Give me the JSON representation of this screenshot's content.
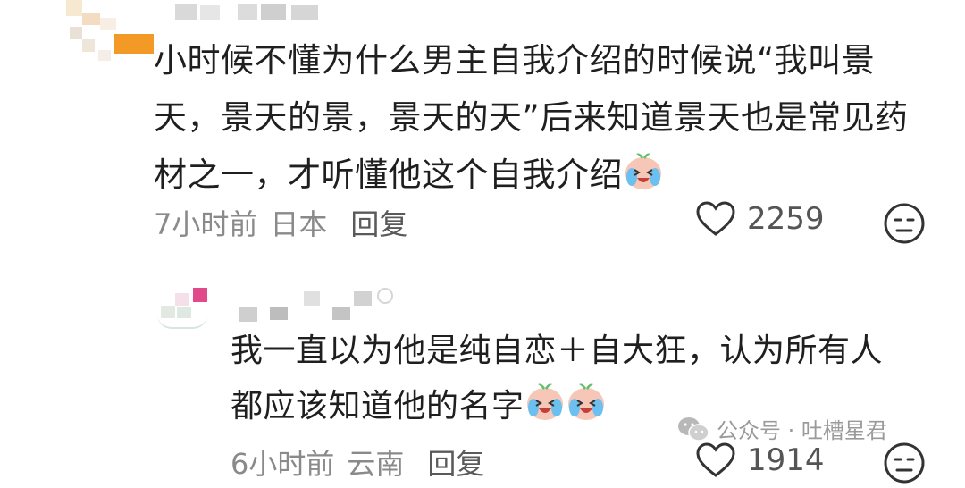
{
  "comments": [
    {
      "lines": [
        "小时候不懂为什么男主自我介绍的时候说“我叫景",
        "天，景天的景，景天的天”后来知道景天也是常见药",
        "材之一，才听懂他这个自我介绍"
      ],
      "time": "7小时前",
      "location": "日本",
      "reply_label": "回复",
      "likes": "2259"
    },
    {
      "lines": [
        "我一直以为他是纯自恋＋自大狂，认为所有人",
        "都应该知道他的名字"
      ],
      "time": "6小时前",
      "location": "云南",
      "reply_label": "回复",
      "likes": "1914"
    }
  ],
  "watermark": {
    "text": "公众号 · 吐槽星君",
    "icon": "wechat-icon"
  },
  "icons": {
    "like": "heart-icon",
    "dislike": "meh-face-icon",
    "emoji": "crying-laughing-emoji-icon"
  }
}
